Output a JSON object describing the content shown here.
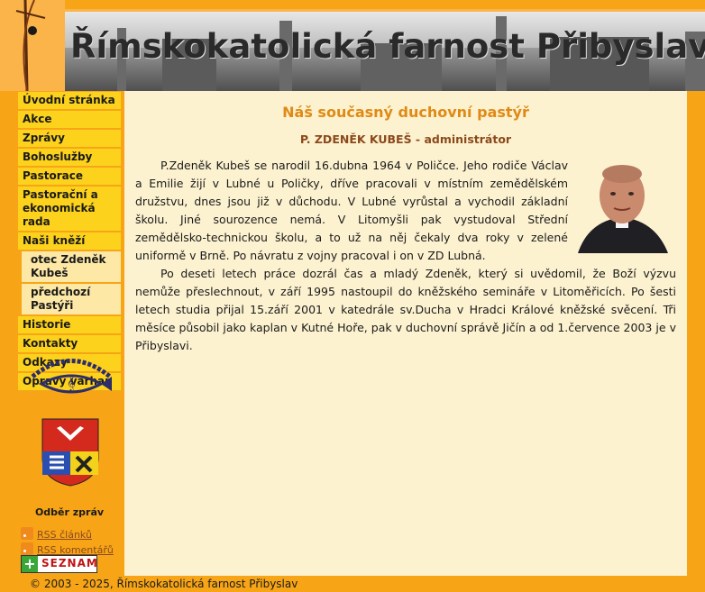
{
  "header": {
    "site_title": "Římskokatolická farnost Přibyslav"
  },
  "sidebar": {
    "items": [
      {
        "label": "Úvodní stránka"
      },
      {
        "label": "Akce"
      },
      {
        "label": "Zprávy"
      },
      {
        "label": "Bohoslužby"
      },
      {
        "label": "Pastorace"
      },
      {
        "label": "Pastorační a ekonomická rada"
      },
      {
        "label": "Naši kněží"
      },
      {
        "label": "otec Zdeněk Kubeš"
      },
      {
        "label": "předchozí Pastýři"
      },
      {
        "label": "Historie"
      },
      {
        "label": "Kontakty"
      },
      {
        "label": "Odkazy"
      },
      {
        "label": "Opravy varhan"
      }
    ],
    "news_title": "Odběr zpráv",
    "rss_articles": "RSS článků",
    "rss_comments": "RSS komentářů",
    "seznam_label": "SEZNAM"
  },
  "main": {
    "title": "Náš současný duchovní pastýř",
    "person": "P. ZDENĚK KUBEŠ - administrátor",
    "paragraph1": "P.Zdeněk Kubeš se narodil 16.dubna 1964 v Poličce. Jeho rodiče Václav a Emilie žijí v Lubné u Poličky, dříve pracovali v místním zemědělském družstvu, dnes jsou již v důchodu. V Lubné vyrůstal a vychodil základní školu. Jiné sourozence nemá. V Litomyšli pak vystudoval Střední zemědělsko-technickou školu, a to už na něj čekaly dva roky v zelené uniformě v Brně. Po návratu z vojny pracoval i on v ZD Lubná.",
    "paragraph2": "Po deseti letech práce dozrál čas a mladý Zdeněk, který si uvědomil, že Boží výzvu nemůže přeslechnout, v září 1995 nastoupil do kněžského semináře v Litoměřicích. Po šesti letech studia přijal 15.září 2001 v katedrále sv.Ducha v Hradci Králové kněžské svěcení. Tři měsíce působil jako kaplan v Kutné Hoře, pak v duchovní správě Jičín a od 1.července 2003 je v Přibyslavi."
  },
  "footer": {
    "copyright": "© 2003 - 2025, Římskokatolická farnost Přibyslav"
  },
  "colors": {
    "accent_orange": "#f7a517",
    "menu_yellow": "#fcd21d",
    "content_bg": "#fdf2d0",
    "title_orange": "#e08a16",
    "name_brown": "#8b4a1c"
  },
  "icons": [
    "rss-icon",
    "plus-icon",
    "nocturno-logo",
    "town-crest",
    "portrait-photo"
  ]
}
